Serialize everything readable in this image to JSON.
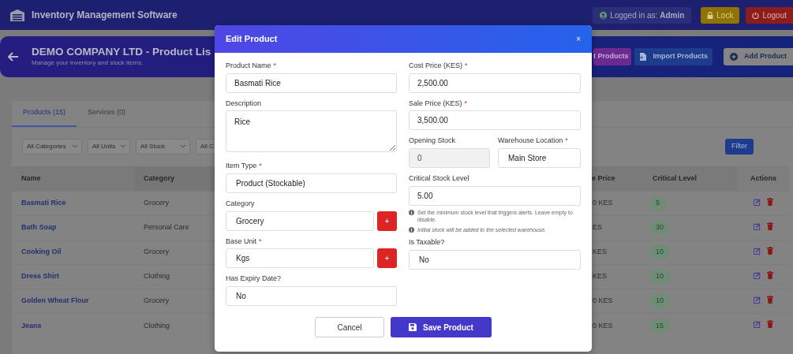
{
  "app": {
    "title": "Inventory Management Software",
    "user_label": "Logged in as: **Admin**",
    "lock": "Lock",
    "logout": "Logout"
  },
  "header": {
    "title": "DEMO COMPANY LTD - Product Lis",
    "subtitle": "Manage your inventory and stock items.",
    "actions": [
      {
        "label": "t Products",
        "kind": "export"
      },
      {
        "label": "Import Products",
        "kind": "import"
      },
      {
        "label": "Add Product",
        "kind": "add"
      }
    ]
  },
  "tabs": [
    {
      "label": "Products (15)",
      "selected": true
    },
    {
      "label": "Services (0)",
      "selected": false
    }
  ],
  "filters": [
    "All Categories",
    "All Units",
    "All Stock",
    "All C"
  ],
  "filter_button": "Filter",
  "table": {
    "columns": [
      "Name",
      "Category",
      "e Price",
      "Critical Level",
      "Actions"
    ],
    "rows": [
      {
        "name": "Basmati Rice",
        "category": "Grocery",
        "price": "0 KES",
        "critical": "5"
      },
      {
        "name": "Bath Soap",
        "category": "Personal Care",
        "price": "ES",
        "critical": "30"
      },
      {
        "name": "Cooking Oil",
        "category": "Grocery",
        "price": "KES",
        "critical": "10"
      },
      {
        "name": "Dress Shirt",
        "category": "Clothing",
        "price": "KES",
        "critical": "10"
      },
      {
        "name": "Golden Wheat Flour",
        "category": "Grocery",
        "price": "0 KES",
        "critical": "10"
      },
      {
        "name": "Jeans",
        "category": "Clothing",
        "price": "0 KES",
        "critical": "15"
      }
    ]
  },
  "modal": {
    "title": "Edit Product",
    "close": "×",
    "left": [
      {
        "kind": "text",
        "label": "Product Name",
        "required_mark": "*",
        "value": "Basmati Rice",
        "disabled": false
      },
      {
        "kind": "textarea",
        "label": "Description",
        "value": "Rice"
      },
      {
        "kind": "select",
        "label": "Item Type",
        "required_mark": "*",
        "value": "Product (Stockable)"
      },
      {
        "kind": "select_add",
        "label": "Category",
        "value": "Grocery",
        "add": "+"
      },
      {
        "kind": "select_add",
        "label": "Base Unit",
        "required_mark": "*",
        "value": "Kgs",
        "add": "+"
      },
      {
        "kind": "select",
        "label": "Has Expiry Date?",
        "value": "No"
      }
    ],
    "right": [
      {
        "kind": "text",
        "label": "Cost Price (KES)",
        "required_mark": "*",
        "value": "2,500.00",
        "disabled": false
      },
      {
        "kind": "text",
        "label": "Sale Price (KES)",
        "required_mark": "*",
        "value": "3,500.00",
        "disabled": false
      },
      {
        "kind": "pair",
        "items": [
          {
            "kind": "text",
            "label": "Opening Stock",
            "value": "0",
            "disabled": true
          },
          {
            "kind": "select",
            "label": "Warehouse Location",
            "required_mark": "*",
            "value": "Main Store"
          }
        ]
      },
      {
        "kind": "text",
        "label": "Critical Stock Level",
        "value": "5.00",
        "disabled": false
      },
      {
        "kind": "help",
        "text": "Set the minimum stock level that triggers alerts. Leave empty to disable.",
        "italic": false
      },
      {
        "kind": "help",
        "text": "Initial stock will be added to the selected warehouse.",
        "italic": true
      },
      {
        "kind": "select",
        "label": "Is Taxable?",
        "value": "No"
      }
    ],
    "cancel": "Cancel",
    "save": "Save Product"
  }
}
